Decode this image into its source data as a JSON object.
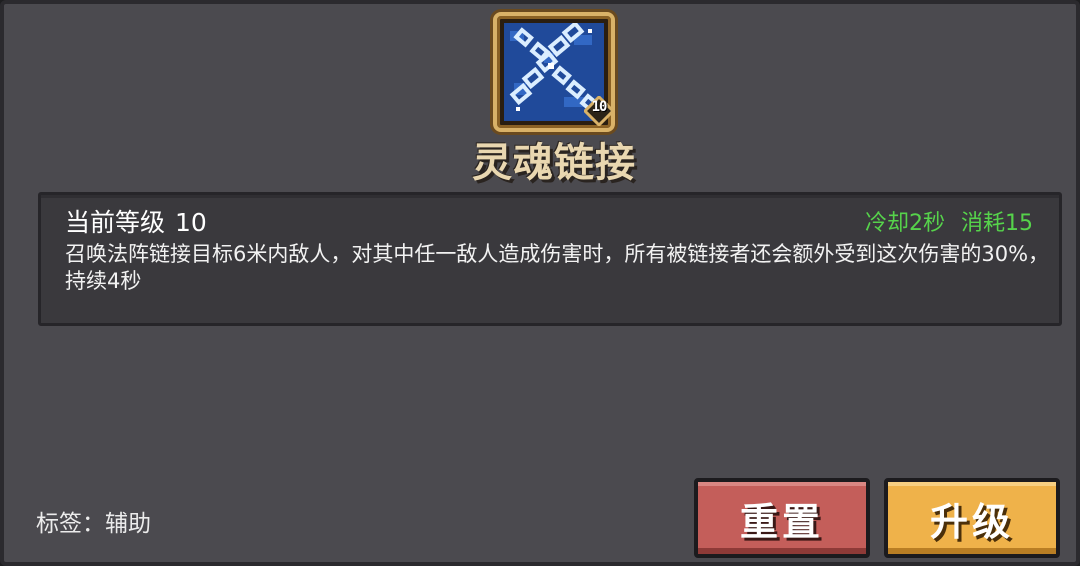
{
  "skill": {
    "name": "灵魂链接",
    "icon": "soul-chain-icon",
    "level_badge": "10"
  },
  "details": {
    "level_label": "当前等级",
    "level_value": "10",
    "cooldown": "冷却2秒",
    "cost": "消耗15",
    "description": "召唤法阵链接目标6米内敌人，对其中任一敌人造成伤害时，所有被链接者还会额外受到这次伤害的30%，持续4秒"
  },
  "tags": {
    "text": "标签：辅助"
  },
  "buttons": {
    "reset": "重置",
    "upgrade": "升级"
  },
  "colors": {
    "panel": "#4b4a4f",
    "stats_green": "#56d34b",
    "reset_red": "#c45e5a",
    "upgrade_gold": "#efb24a",
    "name_cream": "#e9d7b0"
  }
}
